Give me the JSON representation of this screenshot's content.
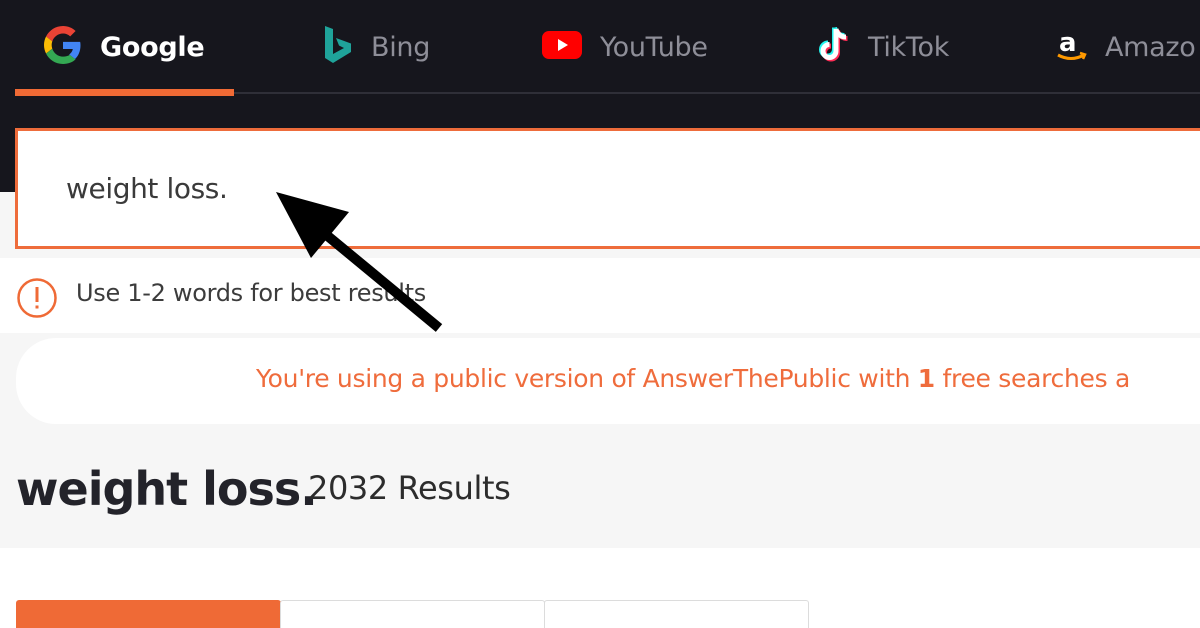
{
  "engines": {
    "tabs": [
      {
        "label": "Google",
        "icon": "google-icon",
        "active": true
      },
      {
        "label": "Bing",
        "icon": "bing-icon",
        "active": false
      },
      {
        "label": "YouTube",
        "icon": "youtube-icon",
        "active": false
      },
      {
        "label": "TikTok",
        "icon": "tiktok-icon",
        "active": false
      },
      {
        "label": "Amazo",
        "icon": "amazon-icon",
        "active": false
      }
    ]
  },
  "search": {
    "value": "weight loss."
  },
  "hint": {
    "icon": "alert-circle-icon",
    "text": "Use 1-2 words for best results"
  },
  "notice": {
    "prefix": "You're using a public version of AnswerThePublic with ",
    "count": "1",
    "suffix": " free searches a"
  },
  "results": {
    "term": "weight loss.",
    "count_label": "2032 Results"
  },
  "colors": {
    "accent": "#ef6a36",
    "topbar": "#16161d",
    "annotation_arrow": "#000000"
  }
}
